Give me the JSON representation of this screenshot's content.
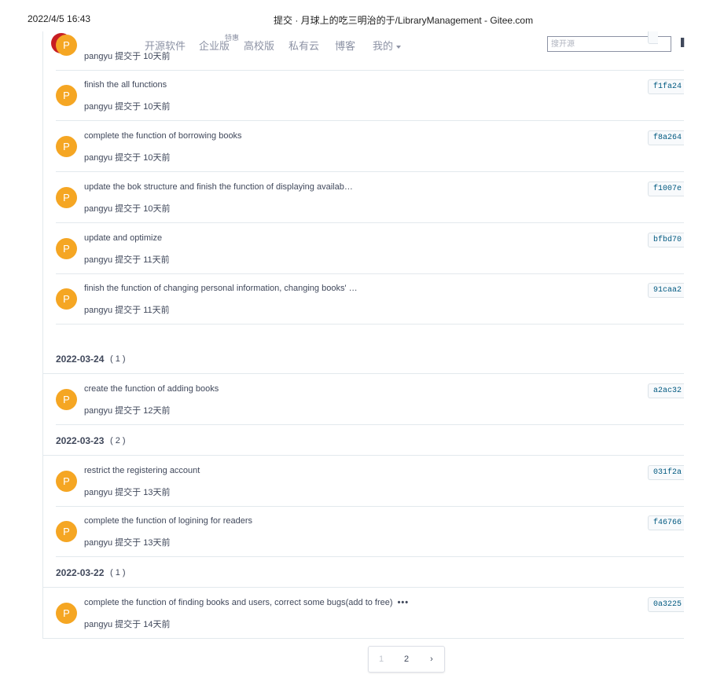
{
  "print_header": {
    "datetime": "2022/4/5 16:43",
    "page_title": "提交 · 月球上的吃三明治的于/LibraryManagement - Gitee.com"
  },
  "navbar": {
    "logo_text": "G",
    "items": [
      "开源软件",
      "企业版",
      "高校版",
      "私有云",
      "博客",
      "我的"
    ],
    "enterprise_badge": "特惠",
    "search_placeholder": "搜开源",
    "colors": {
      "brand": "#c71d23",
      "nav_text": "#8c92a4"
    }
  },
  "commits": {
    "avatar_color": "#f5a623",
    "rows": [
      {
        "message": "",
        "author": "pangyu",
        "time": "提交于 10天前",
        "sha": "",
        "avatar": "P"
      },
      {
        "message": "finish the all functions",
        "author": "pangyu",
        "time": "提交于 10天前",
        "sha": "f1fa24",
        "avatar": "P"
      },
      {
        "message": "complete the function of borrowing books",
        "author": "pangyu",
        "time": "提交于 10天前",
        "sha": "f8a264",
        "avatar": "P"
      },
      {
        "message": "update the bok structure and finish the function of displaying availab…",
        "author": "pangyu",
        "time": "提交于 10天前",
        "sha": "f1007e",
        "avatar": "P"
      },
      {
        "message": "update and optimize",
        "author": "pangyu",
        "time": "提交于 11天前",
        "sha": "bfbd70",
        "avatar": "P"
      },
      {
        "message": "finish the function of changing personal information, changing books' …",
        "author": "pangyu",
        "time": "提交于 11天前",
        "sha": "91caa2",
        "avatar": "P"
      },
      {
        "message": "create the function of adding books",
        "author": "pangyu",
        "time": "提交于 12天前",
        "sha": "a2ac32",
        "avatar": "P"
      },
      {
        "message": "restrict the registering account",
        "author": "pangyu",
        "time": "提交于 13天前",
        "sha": "031f2a",
        "avatar": "P"
      },
      {
        "message": "complete the function of logining for readers",
        "author": "pangyu",
        "time": "提交于 13天前",
        "sha": "f46766",
        "avatar": "P"
      },
      {
        "message": "complete the function of finding books and users, correct some bugs(add to free)",
        "author": "pangyu",
        "time": "提交于 14天前",
        "sha": "0a3225",
        "avatar": "P",
        "more": "•••"
      }
    ],
    "groups": [
      {
        "date": "2022-03-24",
        "count": "( 1 )"
      },
      {
        "date": "2022-03-23",
        "count": "( 2 )"
      },
      {
        "date": "2022-03-22",
        "count": "( 1 )"
      }
    ]
  },
  "pagination": {
    "prev": "1",
    "current": "2",
    "next": "›"
  }
}
